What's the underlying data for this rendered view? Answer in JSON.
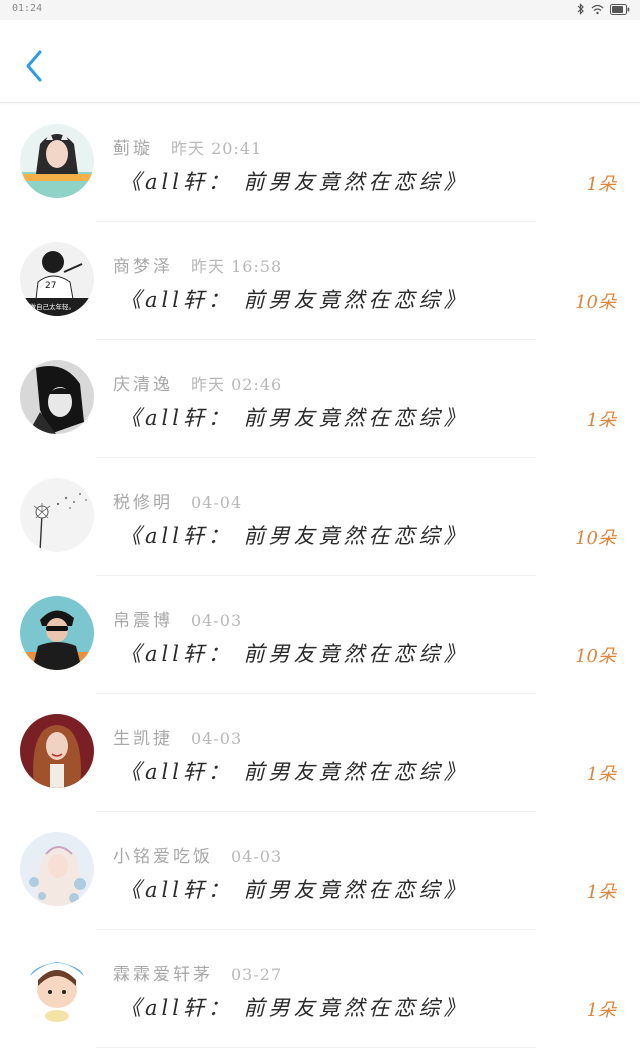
{
  "status_bar": {
    "time": "01:24",
    "icons": [
      "bluetooth-icon",
      "wifi-icon",
      "battery-icon"
    ]
  },
  "header": {
    "back_icon": "chevron-left-icon",
    "accent_color": "#2b9ce8"
  },
  "items": [
    {
      "name": "蓟璇",
      "time": "昨天 20:41",
      "title": "《all轩： 前男友竟然在恋综》",
      "count": "1朵"
    },
    {
      "name": "商梦泽",
      "time": "昨天 16:58",
      "title": "《all轩： 前男友竟然在恋综》",
      "count": "10朵",
      "avatar_caption": "只做自己太年轻。"
    },
    {
      "name": "庆清逸",
      "time": "昨天 02:46",
      "title": "《all轩： 前男友竟然在恋综》",
      "count": "1朵"
    },
    {
      "name": "税修明",
      "time": "04-04",
      "title": "《all轩： 前男友竟然在恋综》",
      "count": "10朵"
    },
    {
      "name": "帛震博",
      "time": "04-03",
      "title": "《all轩： 前男友竟然在恋综》",
      "count": "10朵"
    },
    {
      "name": "生凯捷",
      "time": "04-03",
      "title": "《all轩： 前男友竟然在恋综》",
      "count": "1朵"
    },
    {
      "name": "小铭爱吃饭",
      "time": "04-03",
      "title": "《all轩： 前男友竟然在恋综》",
      "count": "1朵"
    },
    {
      "name": "霖霖爱轩茅",
      "time": "03-27",
      "title": "《all轩： 前男友竟然在恋综》",
      "count": "1朵"
    }
  ],
  "colors": {
    "count": "#e0843a",
    "name": "#a8a8a8",
    "title": "#2a2a2a"
  }
}
